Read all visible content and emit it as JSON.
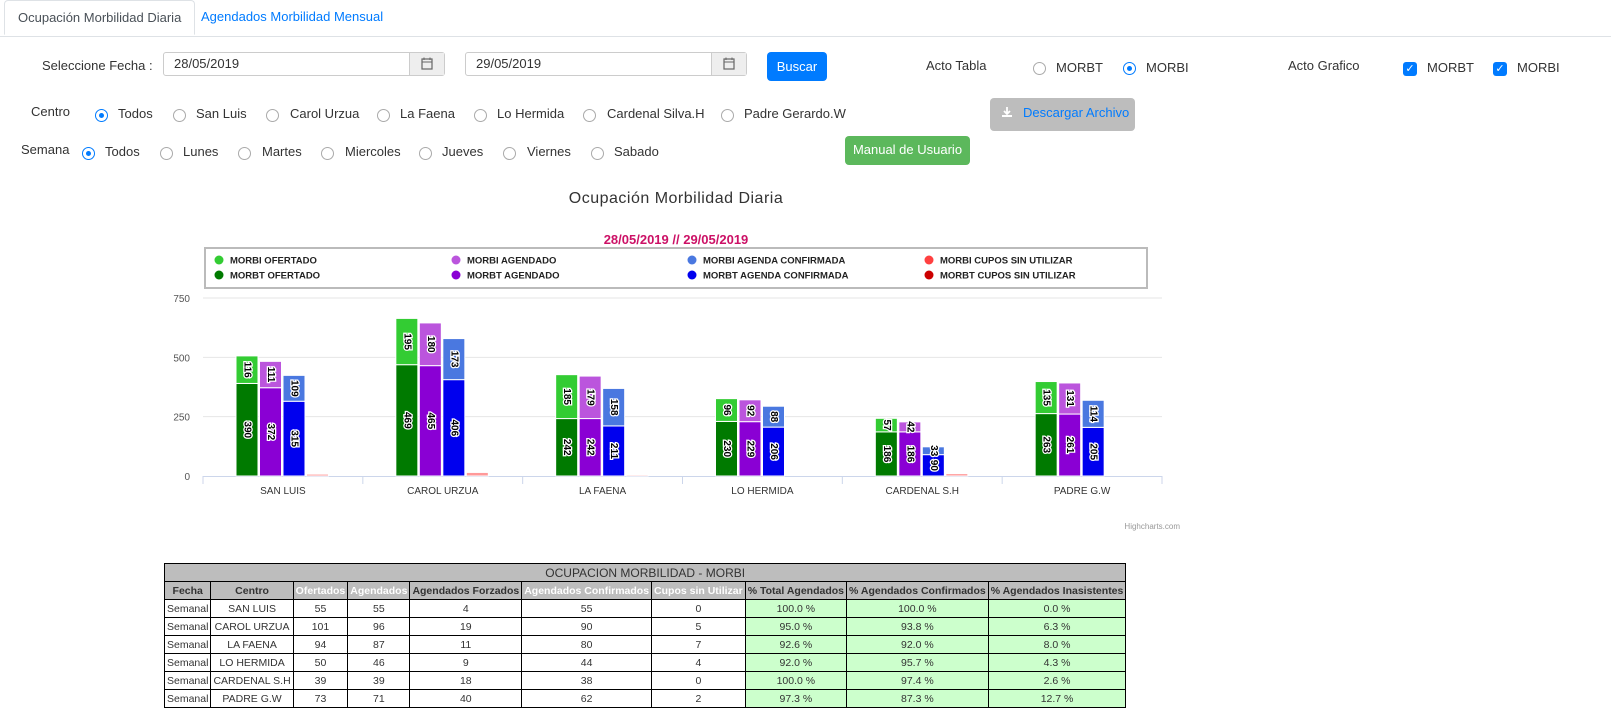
{
  "tabs": [
    "Ocupación Morbilidad Diaria",
    "Agendados Morbilidad Mensual"
  ],
  "filters": {
    "fecha_label": "Seleccione Fecha :",
    "fecha_desde": "28/05/2019",
    "fecha_hasta": "29/05/2019",
    "buscar": "Buscar",
    "acto_tabla_label": "Acto Tabla",
    "acto_tabla_options": [
      "MORBT",
      "MORBI"
    ],
    "acto_tabla_selected": "MORBI",
    "acto_grafico_label": "Acto Grafico",
    "acto_grafico_options": [
      "MORBT",
      "MORBI"
    ],
    "centro_label": "Centro",
    "centro_options": [
      "Todos",
      "San Luis",
      "Carol Urzua",
      "La Faena",
      "Lo Hermida",
      "Cardenal Silva.H",
      "Padre Gerardo.W"
    ],
    "semana_label": "Semana",
    "semana_options": [
      "Todos",
      "Lunes",
      "Martes",
      "Miercoles",
      "Jueves",
      "Viernes",
      "Sabado"
    ],
    "descargar": "Descargar Archivo",
    "manual": "Manual de Usuario"
  },
  "chart_data": {
    "type": "bar",
    "title": "Ocupación Morbilidad Diaria",
    "subtitle": "28/05/2019 // 29/05/2019",
    "categories": [
      "SAN LUIS",
      "CAROL URZUA",
      "LA FAENA",
      "LO HERMIDA",
      "CARDENAL S.H",
      "PADRE G.W"
    ],
    "ylim": [
      0,
      750
    ],
    "yticks": [
      0,
      250,
      500,
      750
    ],
    "legend_position": "top",
    "legend": [
      {
        "name": "MORBI OFERTADO",
        "color": "#33cc33"
      },
      {
        "name": "MORBI AGENDADO",
        "color": "#bb55dd"
      },
      {
        "name": "MORBI AGENDA CONFIRMADA",
        "color": "#4a78e0"
      },
      {
        "name": "MORBI CUPOS SIN UTILIZAR",
        "color": "#ff4040"
      },
      {
        "name": "MORBT OFERTADO",
        "color": "#007a00"
      },
      {
        "name": "MORBT AGENDADO",
        "color": "#8a00d4"
      },
      {
        "name": "MORBT AGENDA CONFIRMADA",
        "color": "#0000ee"
      },
      {
        "name": "MORBT CUPOS SIN UTILIZAR",
        "color": "#cc0000"
      }
    ],
    "stacks": [
      {
        "name": "Ofertado",
        "bottom": [
          390,
          469,
          242,
          230,
          186,
          263
        ],
        "top": [
          116,
          195,
          185,
          96,
          57,
          135
        ],
        "bottom_color": "#007a00",
        "top_color": "#33cc33"
      },
      {
        "name": "Agendado",
        "bottom": [
          372,
          465,
          242,
          229,
          186,
          261
        ],
        "top": [
          111,
          180,
          179,
          92,
          42,
          131
        ],
        "bottom_color": "#8a00d4",
        "top_color": "#bb55dd"
      },
      {
        "name": "Confirmada",
        "bottom": [
          315,
          406,
          211,
          206,
          90,
          205
        ],
        "top": [
          109,
          173,
          158,
          88,
          33,
          114
        ],
        "bottom_color": "#0000ee",
        "top_color": "#4a78e0"
      },
      {
        "name": "Cupos",
        "bottom": [
          8,
          15,
          5,
          0,
          10,
          0
        ],
        "top": [
          0,
          0,
          0,
          0,
          0,
          0
        ],
        "bottom_color": "#ff9999",
        "top_color": "#ff4040"
      }
    ],
    "credit": "Highcharts.com"
  },
  "table": {
    "title": "OCUPACION MORBILIDAD - MORBI",
    "headers": [
      "Fecha",
      "Centro",
      "Ofertados",
      "Agendados",
      "Agendados Forzados",
      "Agendados Confirmados",
      "Cupos sin Utilizar",
      "% Total Agendados",
      "% Agendados Confirmados",
      "% Agendados Inasistentes"
    ],
    "rows": [
      [
        "Semanal",
        "SAN LUIS",
        "55",
        "55",
        "4",
        "55",
        "0",
        "100.0 %",
        "100.0 %",
        "0.0 %"
      ],
      [
        "Semanal",
        "CAROL URZUA",
        "101",
        "96",
        "19",
        "90",
        "5",
        "95.0 %",
        "93.8 %",
        "6.3 %"
      ],
      [
        "Semanal",
        "LA FAENA",
        "94",
        "87",
        "11",
        "80",
        "7",
        "92.6 %",
        "92.0 %",
        "8.0 %"
      ],
      [
        "Semanal",
        "LO HERMIDA",
        "50",
        "46",
        "9",
        "44",
        "4",
        "92.0 %",
        "95.7 %",
        "4.3 %"
      ],
      [
        "Semanal",
        "CARDENAL S.H",
        "39",
        "39",
        "18",
        "38",
        "0",
        "100.0 %",
        "97.4 %",
        "2.6 %"
      ],
      [
        "Semanal",
        "PADRE G.W",
        "73",
        "71",
        "40",
        "62",
        "2",
        "97.3 %",
        "87.3 %",
        "12.7 %"
      ]
    ]
  }
}
